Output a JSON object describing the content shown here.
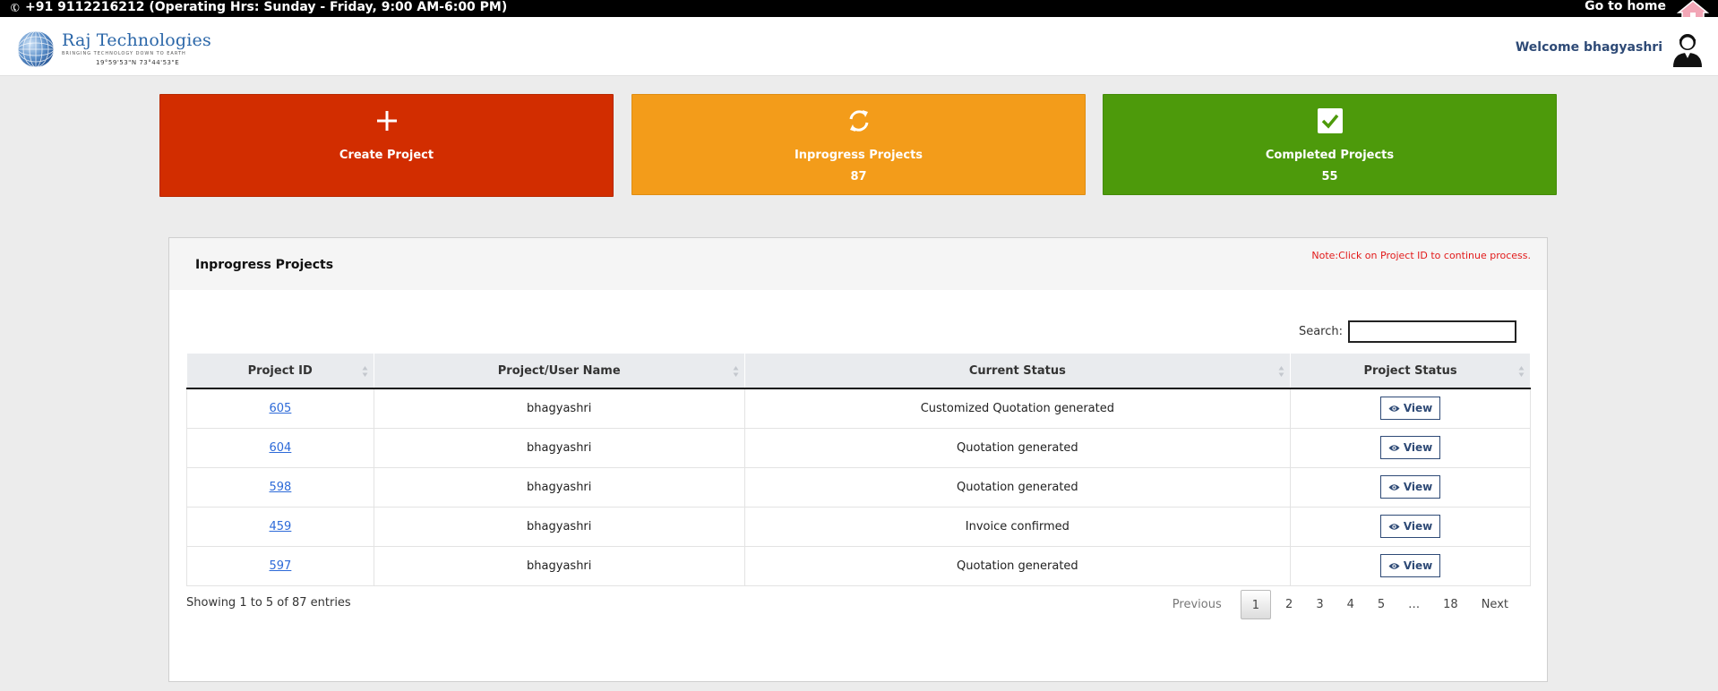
{
  "topbar": {
    "phone_text": "+91 9112216212 (Operating Hrs: Sunday - Friday, 9:00 AM-6:00 PM)",
    "home_link": "Go to home",
    "phone_icon": "phone-icon",
    "home_icon": "home-icon"
  },
  "header": {
    "logo_name": "Raj Technologies",
    "logo_tagline": "BRINGING TECHNOLOGY DOWN TO EARTH",
    "logo_coords": "19°59'53\"N   73°44'53\"E",
    "welcome": "Welcome bhagyashri",
    "avatar_icon": "user-icon"
  },
  "cards": {
    "create": {
      "label": "Create Project",
      "icon": "plus-icon",
      "color": "#d22d00"
    },
    "inprogress": {
      "label": "Inprogress Projects",
      "count": "87",
      "icon": "refresh-icon",
      "color": "#f39c1a"
    },
    "completed": {
      "label": "Completed Projects",
      "count": "55",
      "icon": "checkbox-icon",
      "color": "#4d9a0b"
    }
  },
  "panel": {
    "title": "Inprogress Projects",
    "note": "Note:Click on Project ID to continue process.",
    "search_label": "Search:",
    "search_value": "",
    "columns": [
      "Project ID",
      "Project/User Name",
      "Current Status",
      "Project Status"
    ],
    "rows": [
      {
        "id": "605",
        "user": "bhagyashri",
        "status": "Customized Quotation generated",
        "action": "View"
      },
      {
        "id": "604",
        "user": "bhagyashri",
        "status": "Quotation generated",
        "action": "View"
      },
      {
        "id": "598",
        "user": "bhagyashri",
        "status": "Quotation generated",
        "action": "View"
      },
      {
        "id": "459",
        "user": "bhagyashri",
        "status": "Invoice confirmed",
        "action": "View"
      },
      {
        "id": "597",
        "user": "bhagyashri",
        "status": "Quotation generated",
        "action": "View"
      }
    ],
    "info": "Showing 1 to 5 of 87 entries",
    "pagination": {
      "previous": "Previous",
      "pages": [
        "1",
        "2",
        "3",
        "4",
        "5",
        "…",
        "18"
      ],
      "current": "1",
      "next": "Next"
    }
  }
}
